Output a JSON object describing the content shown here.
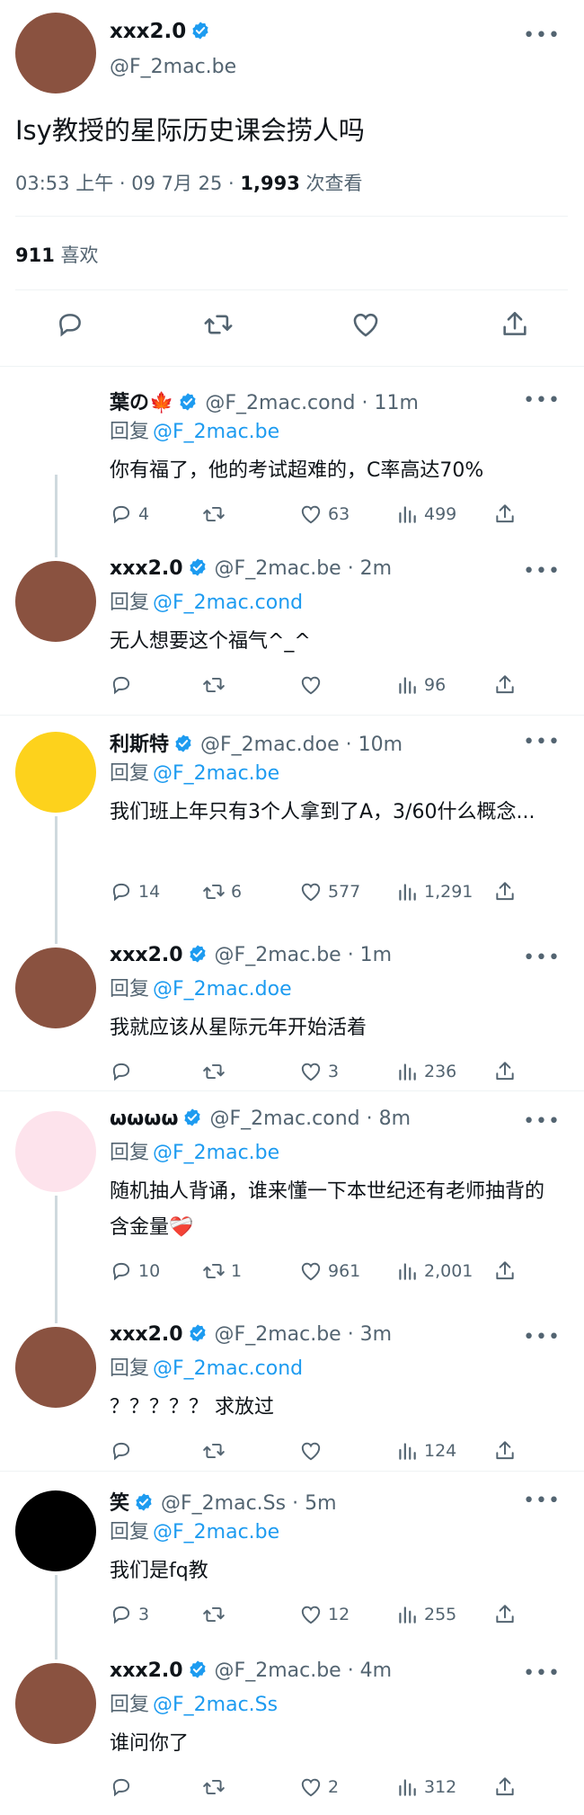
{
  "main_tweet": {
    "name": "xxx2.0",
    "handle": "@F_2mac.be",
    "text": "Isy教授的星际历史课会捞人吗",
    "time": "03:53 上午 · 09 7月 25 · ",
    "views_count": "1,993",
    "views_label": " 次查看",
    "likes_count": "911",
    "likes_label": " 喜欢"
  },
  "replies": [
    {
      "name": "葉の🍁",
      "handle": "@F_2mac.cond · 11m",
      "reply_prefix": "回复",
      "reply_to": "@F_2mac.be",
      "text": "你有福了，他的考试超难的，C率高达70%",
      "replies": "4",
      "retweets": "",
      "likes": "63",
      "views": "499",
      "avatar_color": "#ffffff"
    },
    {
      "name": "xxx2.0",
      "handle": "@F_2mac.be · 2m",
      "reply_prefix": "回复",
      "reply_to": "@F_2mac.cond",
      "text": "无人想要这个福气^_^",
      "replies": "",
      "retweets": "",
      "likes": "",
      "views": "96",
      "avatar_color": "#8a5240"
    },
    {
      "name": "利斯特",
      "handle": "@F_2mac.doe · 10m",
      "reply_prefix": "回复",
      "reply_to": "@F_2mac.be",
      "text": "我们班上年只有3个人拿到了A，3/60什么概念...",
      "replies": "14",
      "retweets": "6",
      "likes": "577",
      "views": "1,291",
      "avatar_color": "#fdd21c"
    },
    {
      "name": "xxx2.0",
      "handle": "@F_2mac.be · 1m",
      "reply_prefix": "回复",
      "reply_to": "@F_2mac.doe",
      "text": "我就应该从星际元年开始活着",
      "replies": "",
      "retweets": "",
      "likes": "3",
      "views": "236",
      "avatar_color": "#8a5240"
    },
    {
      "name": "ωωωω",
      "handle": "@F_2mac.cond · 8m",
      "reply_prefix": "回复",
      "reply_to": "@F_2mac.be",
      "text": "随机抽人背诵，谁来懂一下本世纪还有老师抽背的含金量❤️‍🩹",
      "replies": "10",
      "retweets": "1",
      "likes": "961",
      "views": "2,001",
      "avatar_color": "#fde3ec"
    },
    {
      "name": "xxx2.0",
      "handle": "@F_2mac.be · 3m",
      "reply_prefix": "回复",
      "reply_to": "@F_2mac.cond",
      "text": "？？？？？ 求放过",
      "replies": "",
      "retweets": "",
      "likes": "",
      "views": "124",
      "avatar_color": "#8a5240"
    },
    {
      "name": "笑",
      "handle": "@F_2mac.Ss · 5m",
      "reply_prefix": "回复",
      "reply_to": "@F_2mac.be",
      "text": "我们是fq教",
      "replies": "3",
      "retweets": "",
      "likes": "12",
      "views": "255",
      "avatar_color": "#000000"
    },
    {
      "name": "xxx2.0",
      "handle": "@F_2mac.be · 4m",
      "reply_prefix": "回复",
      "reply_to": "@F_2mac.Ss",
      "text": "谁问你了",
      "replies": "",
      "retweets": "",
      "likes": "2",
      "views": "312",
      "avatar_color": "#8a5240"
    }
  ],
  "icons": {
    "verified": "verified-badge-icon",
    "reply": "reply-icon",
    "retweet": "retweet-icon",
    "like": "heart-icon",
    "views": "views-chart-icon",
    "share": "share-icon",
    "more": "more-dots-icon"
  },
  "colors": {
    "accent": "#1d9bf0",
    "muted": "#536471",
    "text": "#0f1419",
    "divider": "#eff3f4"
  }
}
